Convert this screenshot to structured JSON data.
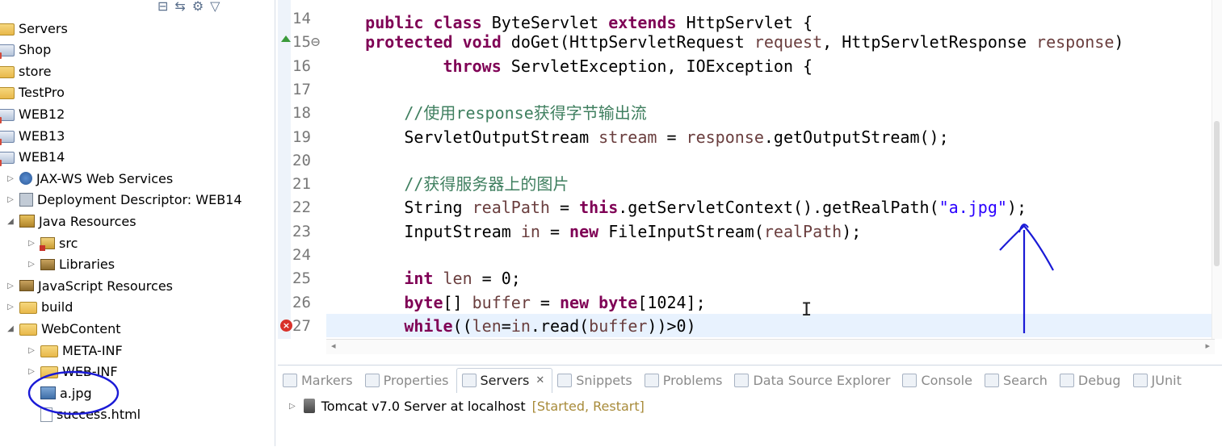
{
  "explorer": {
    "items": [
      {
        "label": "Servers",
        "icon": "folder-icon",
        "indent": 0,
        "twisty": ""
      },
      {
        "label": "Shop",
        "icon": "web-project-icon",
        "indent": 0,
        "twisty": ""
      },
      {
        "label": "store",
        "icon": "folder-icon",
        "indent": 0,
        "twisty": ""
      },
      {
        "label": "TestPro",
        "icon": "folder-icon",
        "indent": 0,
        "twisty": ""
      },
      {
        "label": "WEB12",
        "icon": "web-project-icon",
        "indent": 0,
        "twisty": ""
      },
      {
        "label": "WEB13",
        "icon": "web-project-icon",
        "indent": 0,
        "twisty": ""
      },
      {
        "label": "WEB14",
        "icon": "web-project-icon",
        "indent": 0,
        "twisty": ""
      },
      {
        "label": "JAX-WS Web Services",
        "icon": "web-services-icon",
        "indent": 1,
        "twisty": "▷"
      },
      {
        "label": "Deployment Descriptor: WEB14",
        "icon": "deployment-descriptor-icon",
        "indent": 1,
        "twisty": "▷"
      },
      {
        "label": "Java Resources",
        "icon": "java-resources-icon",
        "indent": 1,
        "twisty": "◢"
      },
      {
        "label": "src",
        "icon": "source-folder-icon",
        "indent": 2,
        "twisty": "▷"
      },
      {
        "label": "Libraries",
        "icon": "libraries-icon",
        "indent": 2,
        "twisty": "▷"
      },
      {
        "label": "JavaScript Resources",
        "icon": "libraries-icon",
        "indent": 1,
        "twisty": "▷"
      },
      {
        "label": "build",
        "icon": "folder-icon",
        "indent": 1,
        "twisty": "▷"
      },
      {
        "label": "WebContent",
        "icon": "folder-icon",
        "indent": 1,
        "twisty": "◢"
      },
      {
        "label": "META-INF",
        "icon": "folder-icon",
        "indent": 2,
        "twisty": "▷"
      },
      {
        "label": "WEB-INF",
        "icon": "folder-icon",
        "indent": 2,
        "twisty": "▷"
      },
      {
        "label": "a.jpg",
        "icon": "image-file-icon",
        "indent": 2,
        "twisty": ""
      },
      {
        "label": "success.html",
        "icon": "html-file-icon",
        "indent": 2,
        "twisty": ""
      }
    ]
  },
  "editor": {
    "top_partial": "public class ByteServlet extends HttpServlet {",
    "lines": [
      {
        "num": "14",
        "code": []
      },
      {
        "num": "15⊖",
        "code": [
          [
            "",
            "    "
          ],
          [
            "kw",
            "protected"
          ],
          [
            "",
            " "
          ],
          [
            "kw",
            "void"
          ],
          [
            "",
            " doGet(HttpServletRequest "
          ],
          [
            "fld",
            "request"
          ],
          [
            "",
            ", HttpServletResponse "
          ],
          [
            "fld",
            "response"
          ],
          [
            "",
            ")"
          ]
        ]
      },
      {
        "num": "16",
        "code": [
          [
            "",
            "            "
          ],
          [
            "kw",
            "throws"
          ],
          [
            "",
            " ServletException, IOException {"
          ]
        ]
      },
      {
        "num": "17",
        "code": []
      },
      {
        "num": "18",
        "code": [
          [
            "",
            "        "
          ],
          [
            "cm",
            "//使用response获得字节输出流"
          ]
        ]
      },
      {
        "num": "19",
        "code": [
          [
            "",
            "        ServletOutputStream "
          ],
          [
            "fld",
            "stream"
          ],
          [
            "",
            " = "
          ],
          [
            "fld",
            "response"
          ],
          [
            "",
            ".getOutputStream();"
          ]
        ]
      },
      {
        "num": "20",
        "code": []
      },
      {
        "num": "21",
        "code": [
          [
            "",
            "        "
          ],
          [
            "cm",
            "//获得服务器上的图片"
          ]
        ]
      },
      {
        "num": "22",
        "code": [
          [
            "",
            "        String "
          ],
          [
            "fld",
            "realPath"
          ],
          [
            "",
            " = "
          ],
          [
            "kw",
            "this"
          ],
          [
            "",
            ".getServletContext().getRealPath("
          ],
          [
            "str",
            "\"a.jpg\""
          ],
          [
            "",
            ");"
          ]
        ]
      },
      {
        "num": "23",
        "code": [
          [
            "",
            "        InputStream "
          ],
          [
            "fld",
            "in"
          ],
          [
            "",
            " = "
          ],
          [
            "kw",
            "new"
          ],
          [
            "",
            " FileInputStream("
          ],
          [
            "fld",
            "realPath"
          ],
          [
            "",
            ");"
          ]
        ]
      },
      {
        "num": "24",
        "code": []
      },
      {
        "num": "25",
        "code": [
          [
            "",
            "        "
          ],
          [
            "kw",
            "int"
          ],
          [
            "",
            " "
          ],
          [
            "fld",
            "len"
          ],
          [
            "",
            " = 0;"
          ]
        ]
      },
      {
        "num": "26",
        "code": [
          [
            "",
            "        "
          ],
          [
            "kw",
            "byte"
          ],
          [
            "",
            "[] "
          ],
          [
            "fld",
            "buffer"
          ],
          [
            "",
            " = "
          ],
          [
            "kw",
            "new"
          ],
          [
            "",
            " "
          ],
          [
            "kw",
            "byte"
          ],
          [
            "",
            "[1024];"
          ]
        ]
      },
      {
        "num": "27",
        "code": [
          [
            "",
            "        "
          ],
          [
            "kw",
            "while"
          ],
          [
            "",
            "(("
          ],
          [
            "fld",
            "len"
          ],
          [
            "",
            "="
          ],
          [
            "fld",
            "in"
          ],
          [
            "",
            ".read("
          ],
          [
            "fld",
            "buffer"
          ],
          [
            "",
            "))>0)"
          ]
        ]
      }
    ]
  },
  "bottom_panel": {
    "tabs": [
      {
        "label": "Markers",
        "icon": "markers-icon",
        "active": false
      },
      {
        "label": "Properties",
        "icon": "properties-icon",
        "active": false
      },
      {
        "label": "Servers",
        "icon": "servers-icon",
        "active": true
      },
      {
        "label": "Snippets",
        "icon": "snippets-icon",
        "active": false
      },
      {
        "label": "Problems",
        "icon": "problems-icon",
        "active": false
      },
      {
        "label": "Data Source Explorer",
        "icon": "data-source-icon",
        "active": false
      },
      {
        "label": "Console",
        "icon": "console-icon",
        "active": false
      },
      {
        "label": "Search",
        "icon": "search-icon",
        "active": false
      },
      {
        "label": "Debug",
        "icon": "debug-icon",
        "active": false
      },
      {
        "label": "JUnit",
        "icon": "junit-icon",
        "active": false
      }
    ],
    "close_glyph": "✕",
    "server": {
      "name": "Tomcat v7.0 Server at localhost",
      "status": "[Started, Restart]"
    }
  },
  "colors": {
    "keyword": "#7f0055",
    "comment": "#3f7f5f",
    "string": "#2a00ff",
    "field": "#6a3e3e",
    "annotation_ink": "#1a1ad6",
    "current_line": "#e8f2fe"
  }
}
